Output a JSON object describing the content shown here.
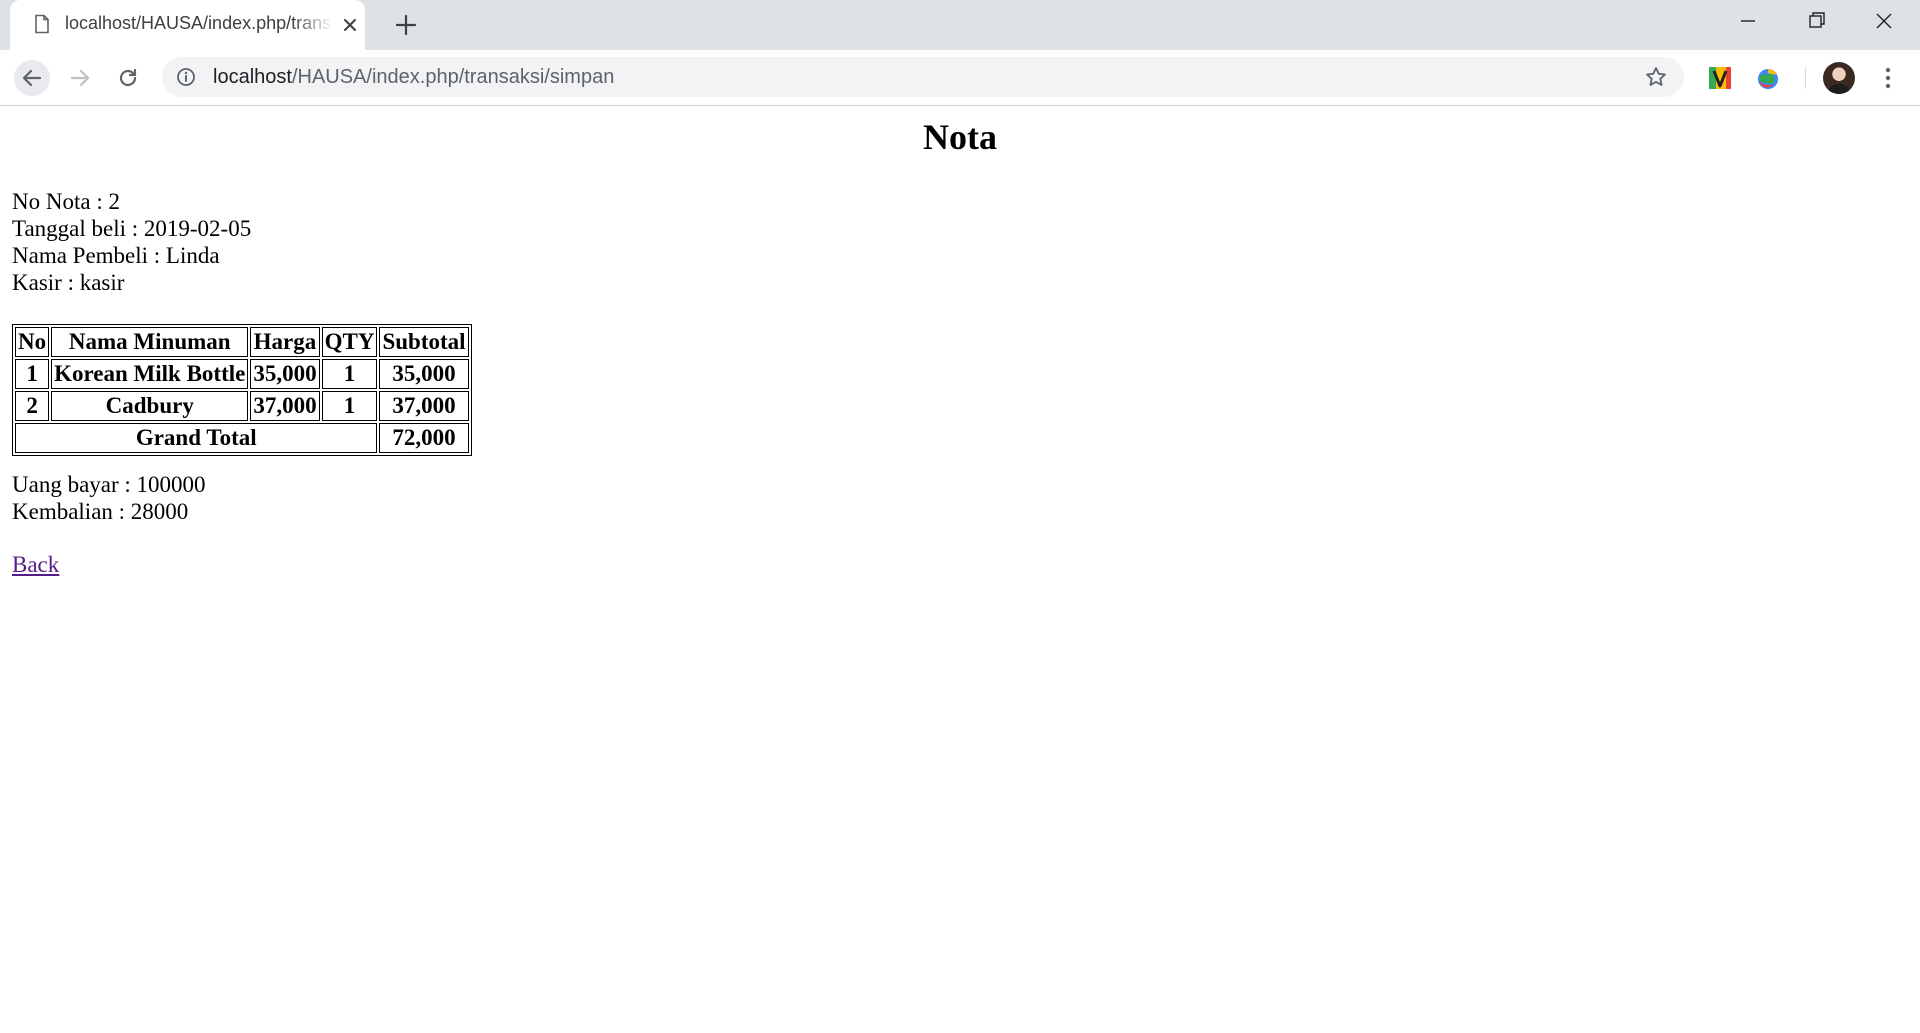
{
  "browser": {
    "tab_title": "localhost/HAUSA/index.php/transaksi/simpan",
    "url_host": "localhost",
    "url_path": "/HAUSA/index.php/transaksi/simpan",
    "icons": {
      "favicon": "document-icon",
      "tab_close": "close-icon",
      "new_tab": "plus-icon",
      "back": "arrow-left-icon",
      "forward": "arrow-right-icon",
      "reload": "reload-icon",
      "site_info": "info-icon",
      "bookmark": "star-icon",
      "extension_1": "v-extension-icon",
      "extension_2": "globe-extension-icon",
      "profile": "avatar",
      "menu": "vertical-dots-icon"
    }
  },
  "page": {
    "title": "Nota",
    "info": [
      {
        "label": "No Nota",
        "value": "2",
        "text": "No Nota : 2"
      },
      {
        "label": "Tanggal beli",
        "value": "2019-02-05",
        "text": "Tanggal beli : 2019-02-05"
      },
      {
        "label": "Nama Pembeli",
        "value": "Linda",
        "text": "Nama Pembeli : Linda"
      },
      {
        "label": "Kasir",
        "value": "kasir",
        "text": "Kasir : kasir"
      }
    ],
    "table": {
      "headers": [
        "No",
        "Nama Minuman",
        "Harga",
        "QTY",
        "Subtotal"
      ],
      "rows": [
        {
          "no": "1",
          "nama": "Korean Milk Bottle",
          "harga": "35,000",
          "qty": "1",
          "subtotal": "35,000"
        },
        {
          "no": "2",
          "nama": "Cadbury",
          "harga": "37,000",
          "qty": "1",
          "subtotal": "37,000"
        }
      ],
      "grand_total_label": "Grand Total",
      "grand_total_value": "72,000"
    },
    "payment": [
      {
        "label": "Uang bayar",
        "value": "100000",
        "text": "Uang bayar : 100000"
      },
      {
        "label": "Kembalian",
        "value": "28000",
        "text": "Kembalian : 28000"
      }
    ],
    "back_link": "Back"
  },
  "colors": {
    "tabstrip": "#dee1e6",
    "omnibox": "#f1f3f4",
    "visited_link": "#551a8b"
  }
}
